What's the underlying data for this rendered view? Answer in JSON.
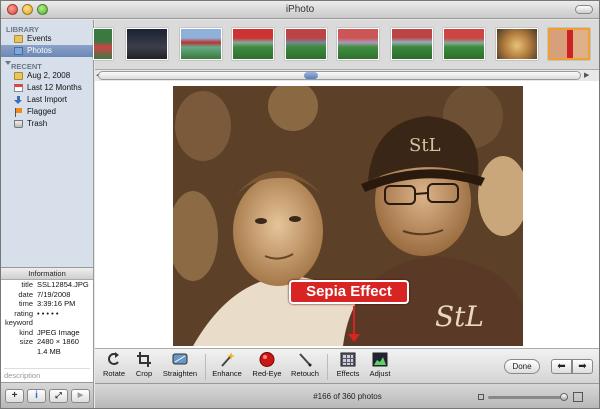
{
  "window": {
    "title": "iPhoto"
  },
  "sidebar": {
    "library_header": "LIBRARY",
    "library_items": [
      {
        "label": "Events",
        "icon": "events-icon"
      },
      {
        "label": "Photos",
        "icon": "photos-icon",
        "selected": true
      }
    ],
    "recent_header": "RECENT",
    "recent_items": [
      {
        "label": "Aug 2, 2008",
        "icon": "event-icon"
      },
      {
        "label": "Last 12 Months",
        "icon": "calendar-icon"
      },
      {
        "label": "Last Import",
        "icon": "import-icon"
      },
      {
        "label": "Flagged",
        "icon": "flag-icon"
      },
      {
        "label": "Trash",
        "icon": "trash-icon"
      }
    ]
  },
  "info": {
    "header": "Information",
    "rows": [
      {
        "key": "title",
        "value": "SSL12854.JPG"
      },
      {
        "key": "date",
        "value": "7/19/2008"
      },
      {
        "key": "time",
        "value": "3:39:16 PM"
      },
      {
        "key": "rating",
        "value": "• • • • •"
      },
      {
        "key": "keyword",
        "value": ""
      },
      {
        "key": "kind",
        "value": "JPEG Image"
      },
      {
        "key": "size",
        "value": "2480 × 1860"
      },
      {
        "key": "",
        "value": "1.4 MB"
      }
    ],
    "description_placeholder": "description"
  },
  "sidebar_buttons": {
    "add": "+",
    "info": "i",
    "fullscreen": "⤢",
    "play": "▶"
  },
  "filmstrip": {
    "thumb_count": 10,
    "selected_index": 9
  },
  "toolbar": {
    "tools": [
      {
        "label": "Rotate",
        "icon": "rotate-icon"
      },
      {
        "label": "Crop",
        "icon": "crop-icon"
      },
      {
        "label": "Straighten",
        "icon": "straighten-icon"
      },
      {
        "label": "Enhance",
        "icon": "enhance-icon"
      },
      {
        "label": "Red-Eye",
        "icon": "red-eye-icon"
      },
      {
        "label": "Retouch",
        "icon": "retouch-icon"
      },
      {
        "label": "Effects",
        "icon": "effects-icon"
      },
      {
        "label": "Adjust",
        "icon": "adjust-icon"
      }
    ],
    "done_label": "Done",
    "prev_label": "⬅",
    "next_label": "➡"
  },
  "callout": {
    "text": "Sepia Effect",
    "color": "#d92424"
  },
  "status": {
    "text": "#166 of 360 photos"
  }
}
